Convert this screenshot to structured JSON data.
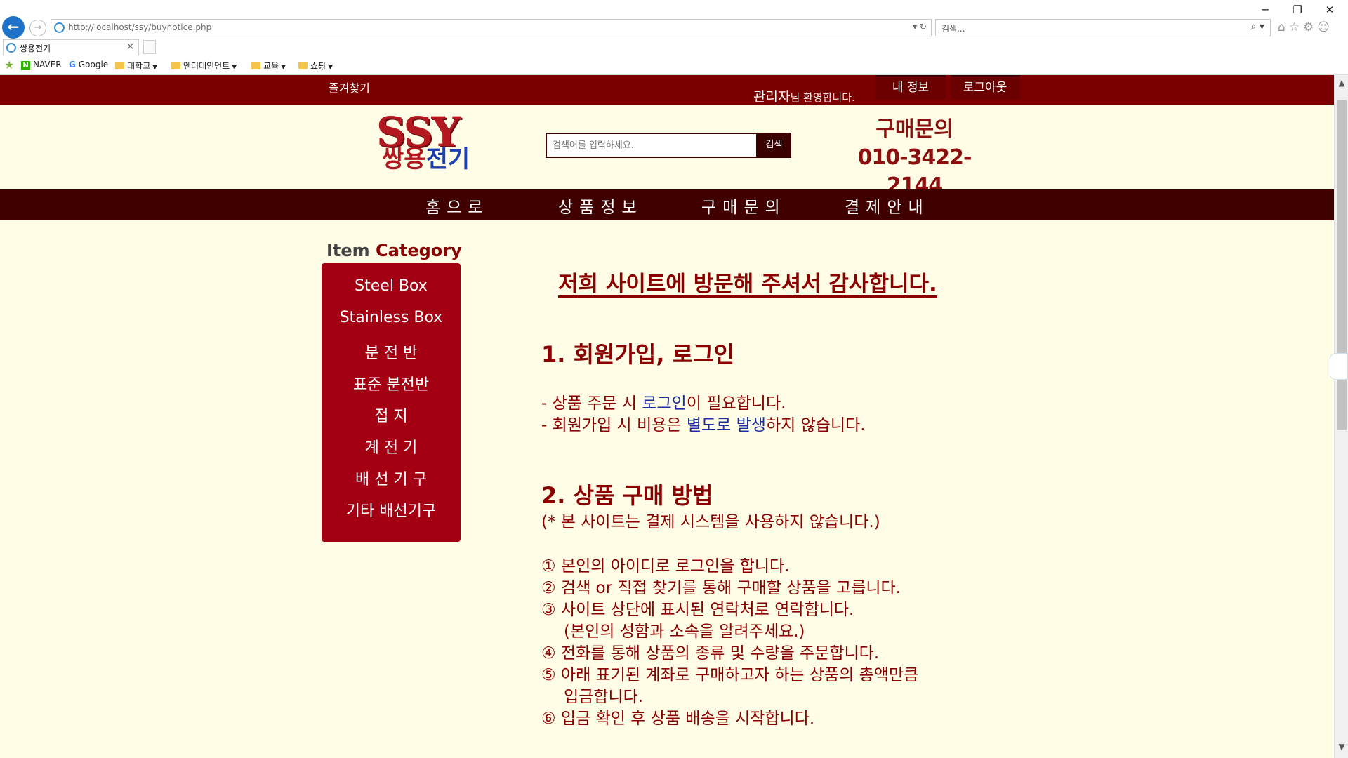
{
  "browser": {
    "window_controls": [
      "─",
      "❐",
      "✕"
    ],
    "url": "http://localhost/ssy/buynotice.php",
    "url_controls": "▾ ↻",
    "search_placeholder": "검색...",
    "search_icon": "⌕ ▾",
    "tool_icons": "⌂☆⚙☺",
    "tab_title": "쌍용전기",
    "tab_close": "×",
    "favorites": [
      {
        "label": "NAVER",
        "icon": "naver-icon"
      },
      {
        "label": "Google",
        "icon": "google-icon"
      },
      {
        "label": "대학교",
        "icon": "folder-icon"
      },
      {
        "label": "엔터테인먼트",
        "icon": "folder-icon"
      },
      {
        "label": "교육",
        "icon": "folder-icon"
      },
      {
        "label": "쇼핑",
        "icon": "folder-icon"
      }
    ]
  },
  "topbar": {
    "favorite_link": "즐겨찾기",
    "welcome_user": "관리자",
    "welcome_rest": "님 환영합니다.",
    "my_info": "내 정보",
    "logout": "로그아웃"
  },
  "header": {
    "logo_en": "SSY",
    "logo_ko_a": "쌍용",
    "logo_ko_b": "전기",
    "search_placeholder": "검색어를 입력하세요.",
    "search_button": "검색",
    "contact_title": "구매문의",
    "contact_phone": "010-3422-2144"
  },
  "nav": [
    "홈으로",
    "상품정보",
    "구매문의",
    "결제안내"
  ],
  "sidebar": {
    "title_a": "Item",
    "title_b": "Category",
    "items": [
      "Steel Box",
      "Stainless Box",
      "분 전 반",
      "표준 분전반",
      "접 지",
      "계 전 기",
      "배 선 기 구",
      "기타 배선기구"
    ]
  },
  "content": {
    "title": "저희 사이트에 방문해 주셔서 감사합니다.",
    "section1": {
      "heading": "1. 회원가입, 로그인",
      "line1_a": "- 상품 주문 시 ",
      "line1_link": "로그인",
      "line1_b": "이 필요합니다.",
      "line2_a": "- 회원가입 시 비용은 ",
      "line2_hl": "별도로 발생",
      "line2_b": "하지 않습니다."
    },
    "section2": {
      "heading": "2. 상품 구매 방법",
      "note": "(* 본 사이트는 결제 시스템을 사용하지 않습니다.)",
      "steps": [
        "① 본인의 아이디로 로그인을 합니다.",
        "② 검색 or 직접 찾기를 통해 구매할 상품을 고릅니다.",
        "③ 사이트 상단에 표시된 연락처로 연락합니다.",
        "(본인의 성함과 소속을 알려주세요.)",
        "④ 전화를 통해 상품의 종류 및 수량을 주문합니다.",
        "⑤ 아래 표기된 계좌로 구매하고자 하는 상품의 총액만큼",
        "입금합니다.",
        "⑥ 입금 확인 후 상품 배송을 시작합니다."
      ]
    }
  },
  "colors": {
    "topbar": "#7a0000",
    "nav": "#400000",
    "sidebar": "#a30014",
    "text": "#8b0000",
    "link": "#1d2fa0",
    "background": "#fffde6"
  }
}
